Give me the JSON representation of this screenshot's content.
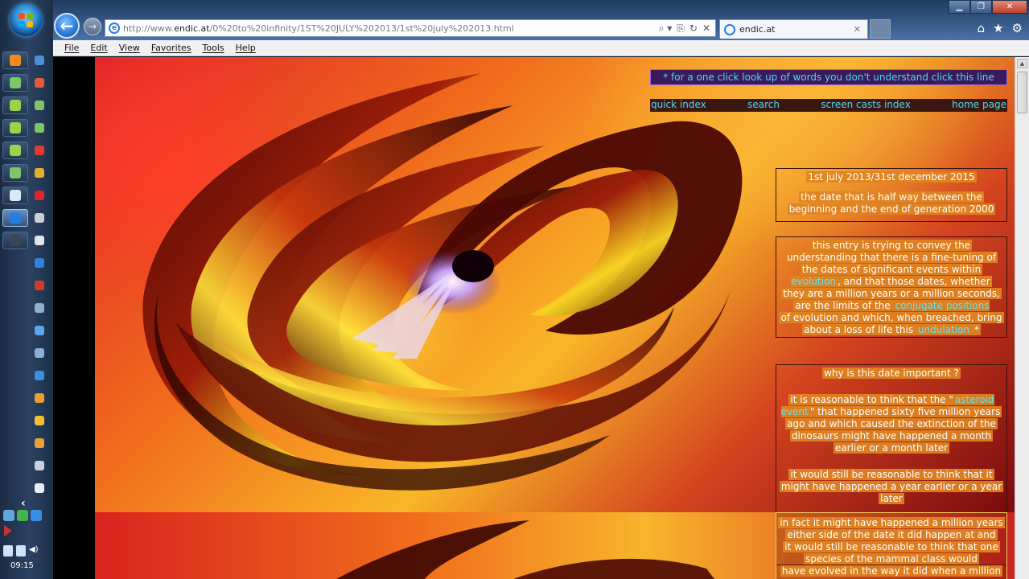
{
  "taskbar": {
    "clock": "09:15",
    "pinned_left": [
      {
        "name": "firefox-icon",
        "color": "#f28a1c"
      },
      {
        "name": "remote-desktop-icon",
        "color": "#7ec56a"
      },
      {
        "name": "notepad-green-icon",
        "color": "#9ad24a"
      },
      {
        "name": "notepad-green-icon-2",
        "color": "#9ad24a"
      },
      {
        "name": "notepad-green-icon-3",
        "color": "#9ad24a"
      },
      {
        "name": "app-green-icon",
        "color": "#7ec56a"
      },
      {
        "name": "document-icon",
        "color": "#d8e8f6"
      },
      {
        "name": "internet-explorer-icon",
        "color": "#2a7de0",
        "active": true
      },
      {
        "name": "command-window-icon",
        "color": "#3a4656"
      }
    ],
    "pinned_right": [
      {
        "name": "monitor-icon",
        "color": "#4d8fd8"
      },
      {
        "name": "paint-icon",
        "color": "#e25b3a"
      },
      {
        "name": "grid-app-icon",
        "color": "#7ec56a"
      },
      {
        "name": "grid-app-icon-2",
        "color": "#7ec56a"
      },
      {
        "name": "chrome-red-icon",
        "color": "#e23b30"
      },
      {
        "name": "media-icon",
        "color": "#e2b12a"
      },
      {
        "name": "red-app-icon",
        "color": "#d8282e"
      },
      {
        "name": "camera-icon",
        "color": "#c7cfd8"
      },
      {
        "name": "film-strip-icon",
        "color": "#dfe5ec"
      },
      {
        "name": "blue-circle-icon",
        "color": "#2f80e0"
      },
      {
        "name": "red-square-icon",
        "color": "#d33a2a"
      },
      {
        "name": "chart-icon",
        "color": "#8fb0d0"
      },
      {
        "name": "globe-icon",
        "color": "#5aa6e8"
      },
      {
        "name": "printer-icon",
        "color": "#8ab0d8"
      },
      {
        "name": "blue-dot-icon",
        "color": "#3d8de0"
      },
      {
        "name": "app-10-icon",
        "color": "#e8a02a"
      },
      {
        "name": "google-icon",
        "color": "#f2c230"
      },
      {
        "name": "chrome-icon",
        "color": "#e8a13a"
      },
      {
        "name": "clapper-icon",
        "color": "#c9d2dc"
      },
      {
        "name": "list-icon",
        "color": "#e7edf3"
      }
    ],
    "tray": [
      {
        "name": "settings-tray-icon",
        "color": "#64a6e0"
      },
      {
        "name": "green-tray-icon",
        "color": "#42b54a"
      },
      {
        "name": "network-tray-icon",
        "color": "#3b8ee6"
      }
    ]
  },
  "browser": {
    "url_prefix": "http://www.",
    "url_domain": "endic.at",
    "url_path": "/0%20to%20infinity/1ST%20JULY%202013/1st%20july%202013.html",
    "tab_title": "endic.at",
    "menu": [
      "File",
      "Edit",
      "View",
      "Favorites",
      "Tools",
      "Help"
    ],
    "address_tools": [
      "⌕ ▾",
      "⎘",
      "↻",
      "✕"
    ],
    "command_icons": [
      "home-icon",
      "star-icon",
      "gear-icon"
    ]
  },
  "page": {
    "lookup_banner": "* for a one click look up of words you don't understand click this line",
    "nav": [
      "quick index",
      "search",
      "screen casts index",
      "home page"
    ],
    "date_box": {
      "heading": "1st july 2013/31st december 2015",
      "line1": "the date that is half way between the",
      "line2": "beginning and the end of generation 2000"
    },
    "entry_box": {
      "l1": "this entry is trying to convey the",
      "l2": "understanding that there is a fine-tuning of",
      "l3": "the dates of significant events within",
      "l4_link": "evolution",
      "l4_rest": ", and that those dates, whether",
      "l5": "they are a million years or a million seconds,",
      "l6_pre": "are the limits of the ",
      "l6_link": "conjugate positions",
      "l7": "of evolution and which, when breached, bring",
      "l8_pre": "about a loss of life this ",
      "l8_link": "undulation",
      "l8_post": " *"
    },
    "why_box": {
      "heading": "why is this date important ?",
      "p1_l1_pre": "it is reasonable to think that the \"",
      "p1_l1_link": "asteroid",
      "p1_l2_link": "event",
      "p1_l2_rest": "\" that happened sixty five million years",
      "p1_l3": "ago and which caused the extinction of the",
      "p1_l4": "dinosaurs might have happened a month",
      "p1_l5": "earlier or a month later",
      "p2_l1": "it would still be reasonable to think that it",
      "p2_l2": "might have happened a year earlier or a year",
      "p2_l3": "later"
    },
    "fact_box": {
      "l1": "in fact it might have happened a million years",
      "l2": "either side of the date it did happen at and",
      "l3": "it would still be reasonable to think  that one",
      "l4": "species of the mammal class would",
      "l5": "have evolved in the way it did when a million"
    }
  }
}
